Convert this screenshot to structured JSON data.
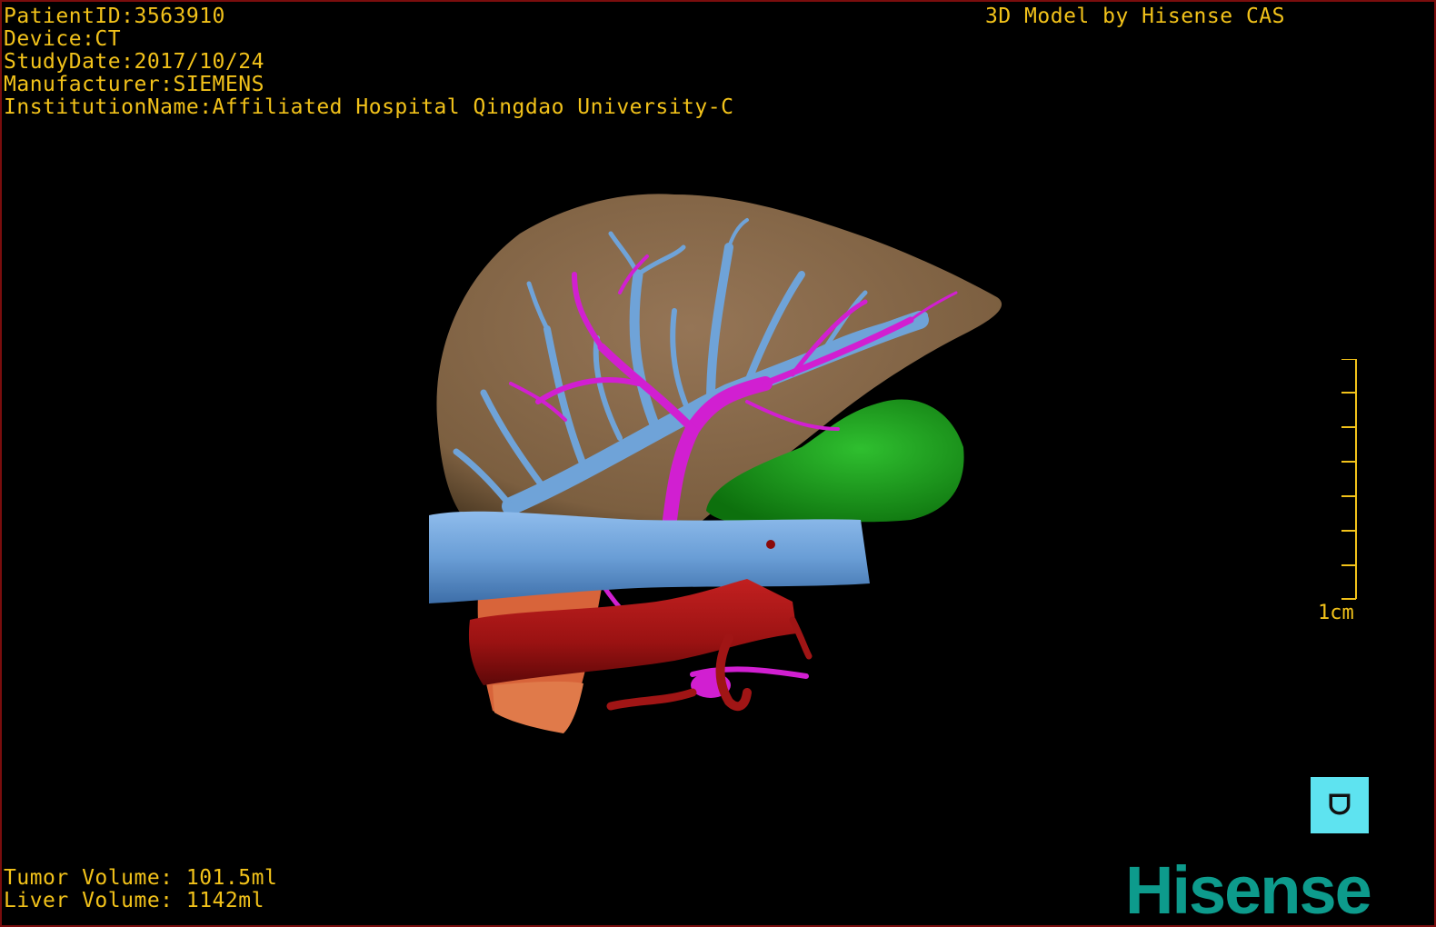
{
  "overlay": {
    "patient_id": "PatientID:3563910",
    "device": "Device:CT",
    "study_date": "StudyDate:2017/10/24",
    "manufacturer": "Manufacturer:SIEMENS",
    "institution": "InstitutionName:Affiliated Hospital Qingdao University-C",
    "title_right": "3D Model by Hisense CAS",
    "tumor_volume": "Tumor Volume: 101.5ml",
    "liver_volume": "Liver Volume: 1142ml"
  },
  "scale_bar": {
    "label": "1cm",
    "ticks": 8
  },
  "orientation_cube": {
    "glyph": "ᗜ",
    "icon": "orientation-cube-icon"
  },
  "brand": {
    "logo": "Hisense",
    "color": "#0d9b8c"
  },
  "colors": {
    "overlay_text": "#f2c21a",
    "liver": "#8a6a48",
    "portal_vein": "#6fa3d8",
    "hepatic_vessels": "#d11fd1",
    "artery": "#a01515",
    "tumor": "#199a19",
    "gallbladder": "#e06a3a",
    "border": "#7a0d0d"
  }
}
